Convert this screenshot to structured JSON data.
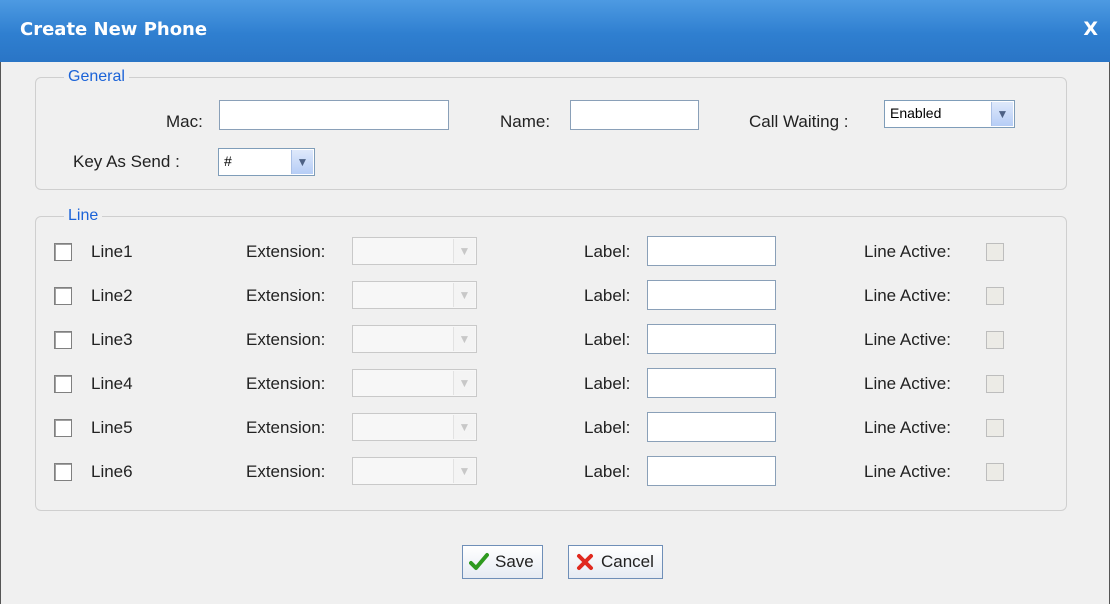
{
  "dialog": {
    "title": "Create New Phone",
    "close_label": "X"
  },
  "general": {
    "legend": "General",
    "mac_label": "Mac:",
    "mac_value": "",
    "name_label": "Name:",
    "name_value": "",
    "call_waiting_label": "Call Waiting :",
    "call_waiting_value": "Enabled",
    "key_as_send_label": "Key As Send :",
    "key_as_send_value": "#"
  },
  "line_section": {
    "legend": "Line",
    "extension_label": "Extension:",
    "label_label": "Label:",
    "line_active_label": "Line Active:",
    "lines": [
      {
        "name": "Line1",
        "checked": false,
        "extension": "",
        "label": "",
        "active": false
      },
      {
        "name": "Line2",
        "checked": false,
        "extension": "",
        "label": "",
        "active": false
      },
      {
        "name": "Line3",
        "checked": false,
        "extension": "",
        "label": "",
        "active": false
      },
      {
        "name": "Line4",
        "checked": false,
        "extension": "",
        "label": "",
        "active": false
      },
      {
        "name": "Line5",
        "checked": false,
        "extension": "",
        "label": "",
        "active": false
      },
      {
        "name": "Line6",
        "checked": false,
        "extension": "",
        "label": "",
        "active": false
      }
    ]
  },
  "buttons": {
    "save_label": "Save",
    "save_icon": "checkmark-icon",
    "cancel_label": "Cancel",
    "cancel_icon": "x-icon"
  },
  "colors": {
    "titlebar": "#2f7fd0",
    "legend_text": "#1b63d8"
  }
}
